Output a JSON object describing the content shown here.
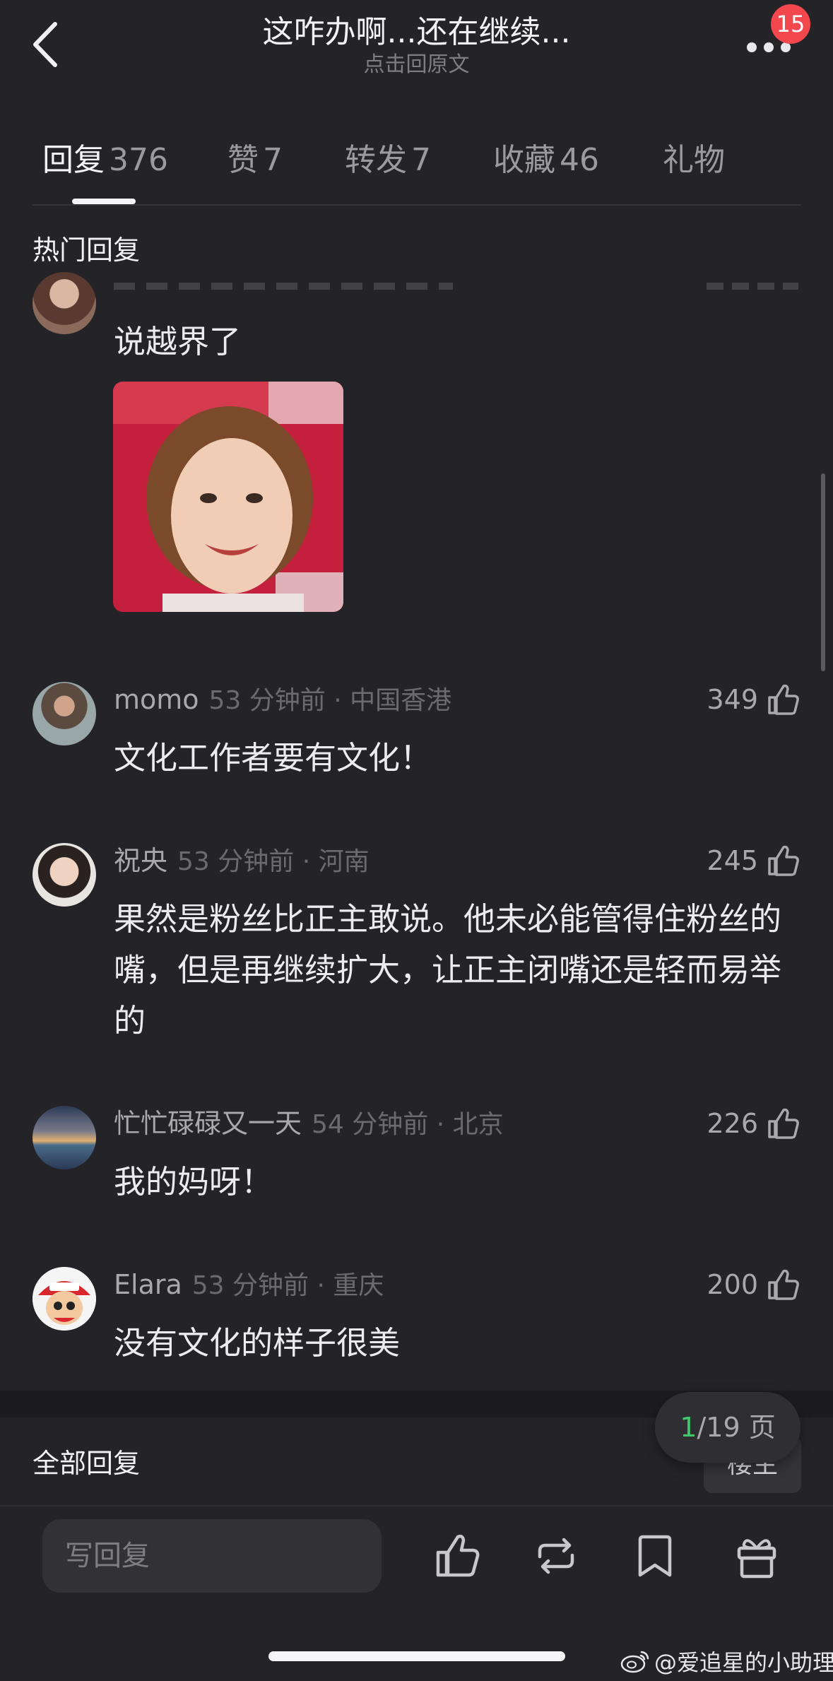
{
  "header": {
    "title": "这咋办啊...还在继续...",
    "subtitle": "点击回原文",
    "badge_count": "15"
  },
  "tabs": [
    {
      "label": "回复",
      "count": "376",
      "active": true
    },
    {
      "label": "赞",
      "count": "7"
    },
    {
      "label": "转发",
      "count": "7"
    },
    {
      "label": "收藏",
      "count": "46"
    },
    {
      "label": "礼物",
      "count": ""
    }
  ],
  "hot_section_title": "热门回复",
  "partial_comment": {
    "text": "说越界了"
  },
  "comments": [
    {
      "user": "momo",
      "time_loc": "53 分钟前 · 中国香港",
      "likes": "349",
      "text": "文化工作者要有文化！"
    },
    {
      "user": "祝央",
      "time_loc": "53 分钟前 · 河南",
      "likes": "245",
      "text": "果然是粉丝比正主敢说。他未必能管得住粉丝的嘴，但是再继续扩大，让正主闭嘴还是轻而易举的"
    },
    {
      "user": "忙忙碌碌又一天",
      "time_loc": "54 分钟前 · 北京",
      "likes": "226",
      "text": "我的妈呀！"
    },
    {
      "user": "Elara",
      "time_loc": "53 分钟前 · 重庆",
      "likes": "200",
      "text": "没有文化的样子很美"
    }
  ],
  "all_section_title": "全部回复",
  "louzhu_label": "楼主",
  "pagination": {
    "current": "1",
    "total": "/19 页"
  },
  "composer": {
    "placeholder": "写回复"
  },
  "watermark": "@爱追星的小助理",
  "colors": {
    "background": "#242428",
    "badge": "#f2484d",
    "page_current": "#3fc96a"
  }
}
